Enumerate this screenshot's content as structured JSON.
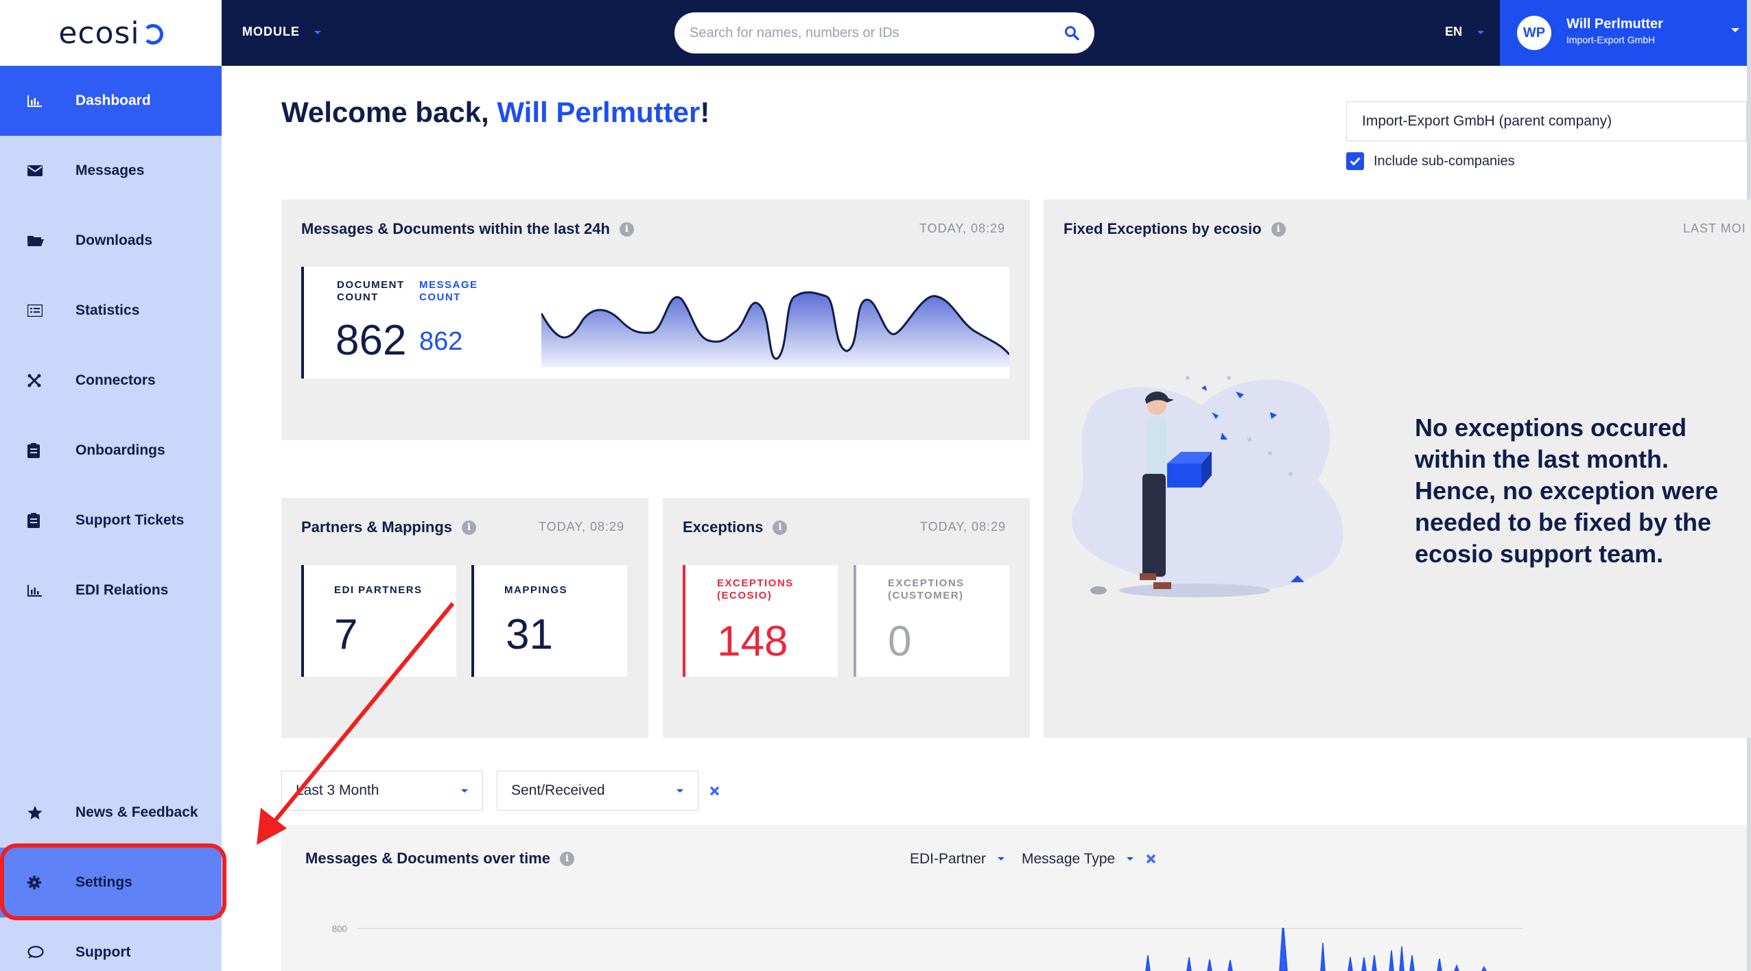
{
  "brand": {
    "logo_text": "ecosi",
    "accent": "#1d4ff0",
    "navy": "#0d1b4b",
    "red": "#e8283c"
  },
  "sidebar": {
    "items": [
      {
        "label": "Dashboard",
        "icon": "bar-chart-icon"
      },
      {
        "label": "Messages",
        "icon": "envelope-icon"
      },
      {
        "label": "Downloads",
        "icon": "folder-icon"
      },
      {
        "label": "Statistics",
        "icon": "list-icon"
      },
      {
        "label": "Connectors",
        "icon": "connector-icon"
      },
      {
        "label": "Onboardings",
        "icon": "clipboard-icon"
      },
      {
        "label": "Support Tickets",
        "icon": "ticket-icon"
      },
      {
        "label": "EDI Relations",
        "icon": "bar-chart-icon"
      },
      {
        "label": "News & Feedback",
        "icon": "star-icon"
      },
      {
        "label": "Settings",
        "icon": "gear-icon"
      },
      {
        "label": "Support",
        "icon": "chat-bubble-icon"
      }
    ],
    "active": "Dashboard",
    "highlighted": "Settings"
  },
  "topbar": {
    "module_label": "MODULE",
    "search_placeholder": "Search for names, numbers or IDs",
    "language": "EN",
    "user": {
      "initials": "WP",
      "name": "Will Perlmutter",
      "company": "Import-Export GmbH"
    }
  },
  "welcome": {
    "prefix": "Welcome back, ",
    "name": "Will Perlmutter",
    "suffix": "!"
  },
  "company_filter": {
    "value": "Import-Export GmbH (parent company)",
    "include_sub_label": "Include sub-companies",
    "include_sub_checked": true
  },
  "cards": {
    "messages24h": {
      "title": "Messages & Documents within the last 24h",
      "timestamp": "TODAY, 08:29",
      "doc_label_1": "DOCUMENT",
      "doc_label_2": "COUNT",
      "msg_label_1": "MESSAGE",
      "msg_label_2": "COUNT",
      "doc_count": "862",
      "msg_count": "862"
    },
    "partners": {
      "title": "Partners & Mappings",
      "timestamp": "TODAY, 08:29",
      "edi_label": "EDI PARTNERS",
      "edi_value": "7",
      "map_label": "MAPPINGS",
      "map_value": "31"
    },
    "exceptions": {
      "title": "Exceptions",
      "timestamp": "TODAY, 08:29",
      "ecosio_label_1": "EXCEPTIONS",
      "ecosio_label_2": "(ECOSIO)",
      "ecosio_value": "148",
      "cust_label_1": "EXCEPTIONS",
      "cust_label_2": "(CUSTOMER)",
      "cust_value": "0"
    },
    "fixed": {
      "title": "Fixed Exceptions by ecosio",
      "timestamp": "LAST MOI",
      "message": "No exceptions occured within the last month. Hence, no exception were needed to be fixed by the ecosio support team."
    },
    "overtime": {
      "title": "Messages & Documents over time",
      "filter_partner": "EDI-Partner",
      "filter_type": "Message Type",
      "y_tick": "800"
    }
  },
  "filters": {
    "range": "Last 3 Month",
    "direction": "Sent/Received"
  }
}
